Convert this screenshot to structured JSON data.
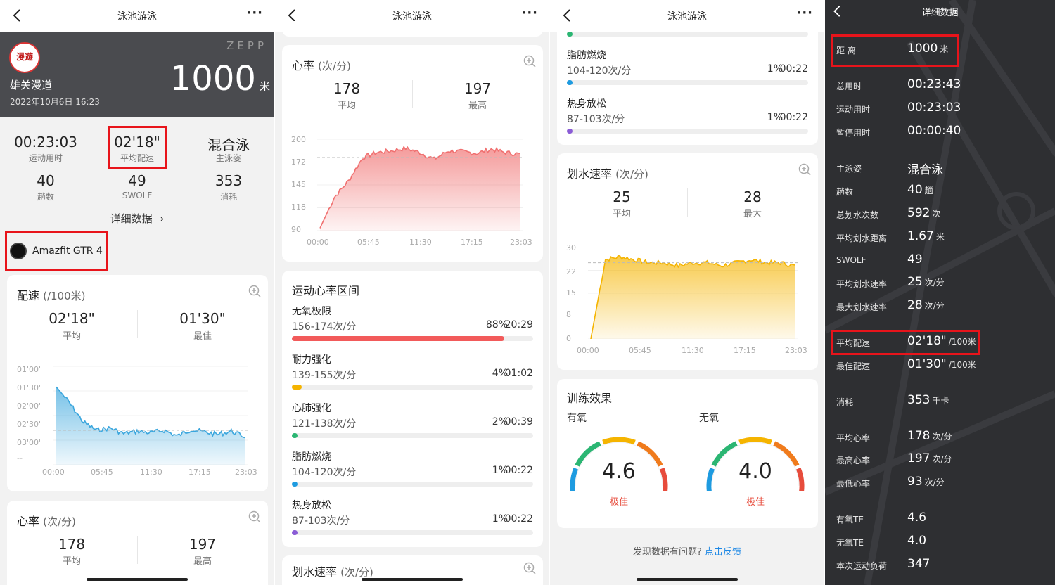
{
  "app": {
    "title": "泳池游泳",
    "more": "···"
  },
  "s1": {
    "brand": "ZΕPP",
    "avatar_text": "漫遊",
    "user_name": "雄关漫道",
    "datetime": "2022年10月6日 16:23",
    "distance": {
      "value": "1000",
      "unit": "米"
    },
    "stats": [
      {
        "value": "00:23:03",
        "label": "运动用时"
      },
      {
        "value": "02'18\"",
        "label": "平均配速"
      },
      {
        "value": "混合泳",
        "label": "主泳姿"
      },
      {
        "value": "40",
        "label": "趟数"
      },
      {
        "value": "49",
        "label": "SWOLF"
      },
      {
        "value": "353",
        "label": "消耗"
      }
    ],
    "detail_link": "详细数据",
    "device": "Amazfit GTR 4",
    "pace_card": {
      "title": "配速",
      "unit": "(/100米)",
      "avg": {
        "value": "02'18\"",
        "label": "平均"
      },
      "best": {
        "value": "01'30\"",
        "label": "最佳"
      },
      "y_ticks": [
        "01'00\"",
        "01'30\"",
        "02'00\"",
        "02'30\"",
        "03'00\"",
        "--"
      ],
      "x_ticks": [
        "00:00",
        "05:45",
        "11:30",
        "17:15",
        "23:03"
      ]
    },
    "hr_card": {
      "title": "心率",
      "unit": "(次/分)",
      "avg": {
        "value": "178",
        "label": "平均"
      },
      "max": {
        "value": "197",
        "label": "最高"
      }
    }
  },
  "s2": {
    "hr_card": {
      "title": "心率",
      "unit": "(次/分)",
      "avg": {
        "value": "178",
        "label": "平均"
      },
      "max": {
        "value": "197",
        "label": "最高"
      },
      "y_ticks": [
        "200",
        "172",
        "145",
        "118",
        "90"
      ],
      "x_ticks": [
        "00:00",
        "05:45",
        "11:30",
        "17:15",
        "23:03"
      ]
    },
    "zones_card": {
      "title": "运动心率区间",
      "zones": [
        {
          "name": "无氧极限",
          "range": "156-174次/分",
          "pct": "88%",
          "time": "20:29",
          "color": "#f25a5a",
          "fill": 0.88
        },
        {
          "name": "耐力强化",
          "range": "139-155次/分",
          "pct": "4%",
          "time": "01:02",
          "color": "#f5b400",
          "fill": 0.04
        },
        {
          "name": "心肺强化",
          "range": "121-138次/分",
          "pct": "2%",
          "time": "00:39",
          "color": "#2bb673",
          "fill": 0.02
        },
        {
          "name": "脂肪燃烧",
          "range": "104-120次/分",
          "pct": "1%",
          "time": "00:22",
          "color": "#1e9be0",
          "fill": 0.01
        },
        {
          "name": "热身放松",
          "range": "87-103次/分",
          "pct": "1%",
          "time": "00:22",
          "color": "#8a5cd6",
          "fill": 0.01
        }
      ]
    },
    "stroke_peek": {
      "title": "划水速率",
      "unit": "(次/分)"
    }
  },
  "s3": {
    "zones": [
      {
        "name": "脂肪燃烧",
        "range": "104-120次/分",
        "pct": "1%",
        "time": "00:22",
        "color": "#1e9be0",
        "fill": 0.01
      },
      {
        "name": "热身放松",
        "range": "87-103次/分",
        "pct": "1%",
        "time": "00:22",
        "color": "#8a5cd6",
        "fill": 0.01
      }
    ],
    "stroke_card": {
      "title": "划水速率",
      "unit": "(次/分)",
      "avg": {
        "value": "25",
        "label": "平均"
      },
      "max": {
        "value": "28",
        "label": "最大"
      },
      "y_ticks": [
        "30",
        "22",
        "15",
        "8",
        "0"
      ],
      "x_ticks": [
        "00:00",
        "05:45",
        "11:30",
        "17:15",
        "23:03"
      ]
    },
    "training": {
      "title": "训练效果",
      "aerobic": {
        "label": "有氧",
        "value": "4.6",
        "grade": "极佳",
        "level": 4.6
      },
      "anaerobic": {
        "label": "无氧",
        "value": "4.0",
        "grade": "极佳",
        "level": 4.0
      }
    },
    "feedback": {
      "question": "发现数据有问题?",
      "link": "点击反馈"
    }
  },
  "s4": {
    "title": "详细数据",
    "rows": [
      {
        "k": "距 离",
        "v": "1000",
        "u": "米"
      },
      {
        "k": "总用时",
        "v": "00:23:43",
        "u": ""
      },
      {
        "k": "运动用时",
        "v": "00:23:03",
        "u": ""
      },
      {
        "k": "暂停用时",
        "v": "00:00:40",
        "u": ""
      },
      {
        "k": "主泳姿",
        "v": "混合泳",
        "u": ""
      },
      {
        "k": "趟数",
        "v": "40",
        "u": "趟"
      },
      {
        "k": "总划水次数",
        "v": "592",
        "u": "次"
      },
      {
        "k": "平均划水距离",
        "v": "1.67",
        "u": "米"
      },
      {
        "k": "SWOLF",
        "v": "49",
        "u": ""
      },
      {
        "k": "平均划水速率",
        "v": "25",
        "u": "次/分"
      },
      {
        "k": "最大划水速率",
        "v": "28",
        "u": "次/分"
      },
      {
        "k": "平均配速",
        "v": "02'18\"",
        "u": "/100米"
      },
      {
        "k": "最佳配速",
        "v": "01'30\"",
        "u": "/100米"
      },
      {
        "k": "消耗",
        "v": "353",
        "u": "千卡"
      },
      {
        "k": "平均心率",
        "v": "178",
        "u": "次/分"
      },
      {
        "k": "最高心率",
        "v": "197",
        "u": "次/分"
      },
      {
        "k": "最低心率",
        "v": "93",
        "u": "次/分"
      },
      {
        "k": "有氧TE",
        "v": "4.6",
        "u": ""
      },
      {
        "k": "无氧TE",
        "v": "4.0",
        "u": ""
      },
      {
        "k": "本次运动负荷",
        "v": "347",
        "u": ""
      }
    ]
  },
  "chart_data": [
    {
      "type": "area",
      "title": "配速 (/100米)",
      "y_axis_labels": [
        "01'00\"",
        "01'30\"",
        "02'00\"",
        "02'30\"",
        "03'00\""
      ],
      "x": [
        "00:00",
        "05:45",
        "11:30",
        "17:15",
        "23:03"
      ],
      "ylim_seconds": [
        60,
        180
      ],
      "y_inverted": true,
      "series": [
        {
          "values_seconds": [
            85,
            105,
            128,
            138,
            135,
            142,
            139,
            141,
            138,
            145,
            137,
            140,
            143,
            139,
            146
          ]
        }
      ],
      "average_line_seconds": 138,
      "color": "#3aa6dd"
    },
    {
      "type": "area",
      "title": "心率 (次/分)",
      "x": [
        "00:00",
        "05:45",
        "11:30",
        "17:15",
        "23:03"
      ],
      "ylim": [
        90,
        200
      ],
      "series": [
        {
          "values": [
            93,
            130,
            150,
            178,
            184,
            186,
            189,
            184,
            176,
            186,
            185,
            183,
            188,
            184,
            182
          ]
        }
      ],
      "average_line": 178,
      "color": "#f07070"
    },
    {
      "type": "area",
      "title": "划水速率 (次/分)",
      "x": [
        "00:00",
        "05:45",
        "11:30",
        "17:15",
        "23:03"
      ],
      "ylim": [
        0,
        30
      ],
      "series": [
        {
          "values": [
            0,
            26,
            27,
            26,
            25,
            25,
            24,
            25,
            25,
            24,
            25,
            26,
            25,
            25,
            24
          ]
        }
      ],
      "average_line": 25,
      "color": "#f5b400"
    }
  ]
}
